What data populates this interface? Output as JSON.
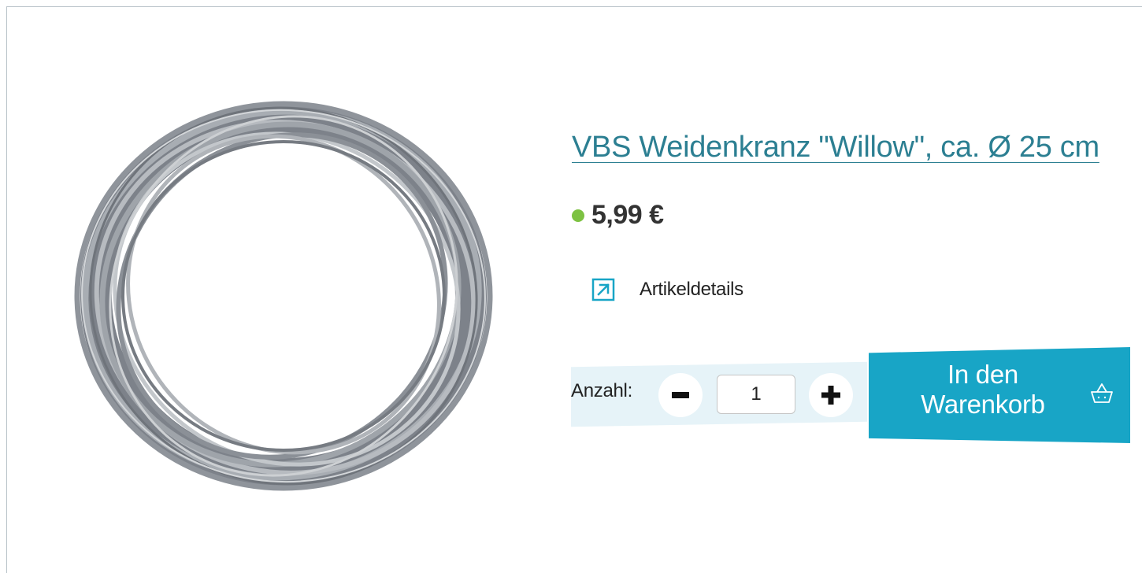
{
  "product": {
    "title": "VBS Weidenkranz \"Willow\", ca. Ø 25 cm",
    "image_alt": "Grey willow wreath",
    "price": "5,99 €",
    "availability_color": "#7dc242",
    "details_link_label": "Artikeldetails",
    "details_icon": "external-link-arrow-icon"
  },
  "quantity": {
    "label": "Anzahl:",
    "value": "1",
    "decrement_icon": "minus-icon",
    "increment_icon": "plus-icon"
  },
  "cart": {
    "button_label": "In den Warenkorb",
    "icon": "basket-icon",
    "color": "#18a5c6"
  },
  "colors": {
    "title": "#2c7f92",
    "quantity_background": "#e6f3f8"
  }
}
